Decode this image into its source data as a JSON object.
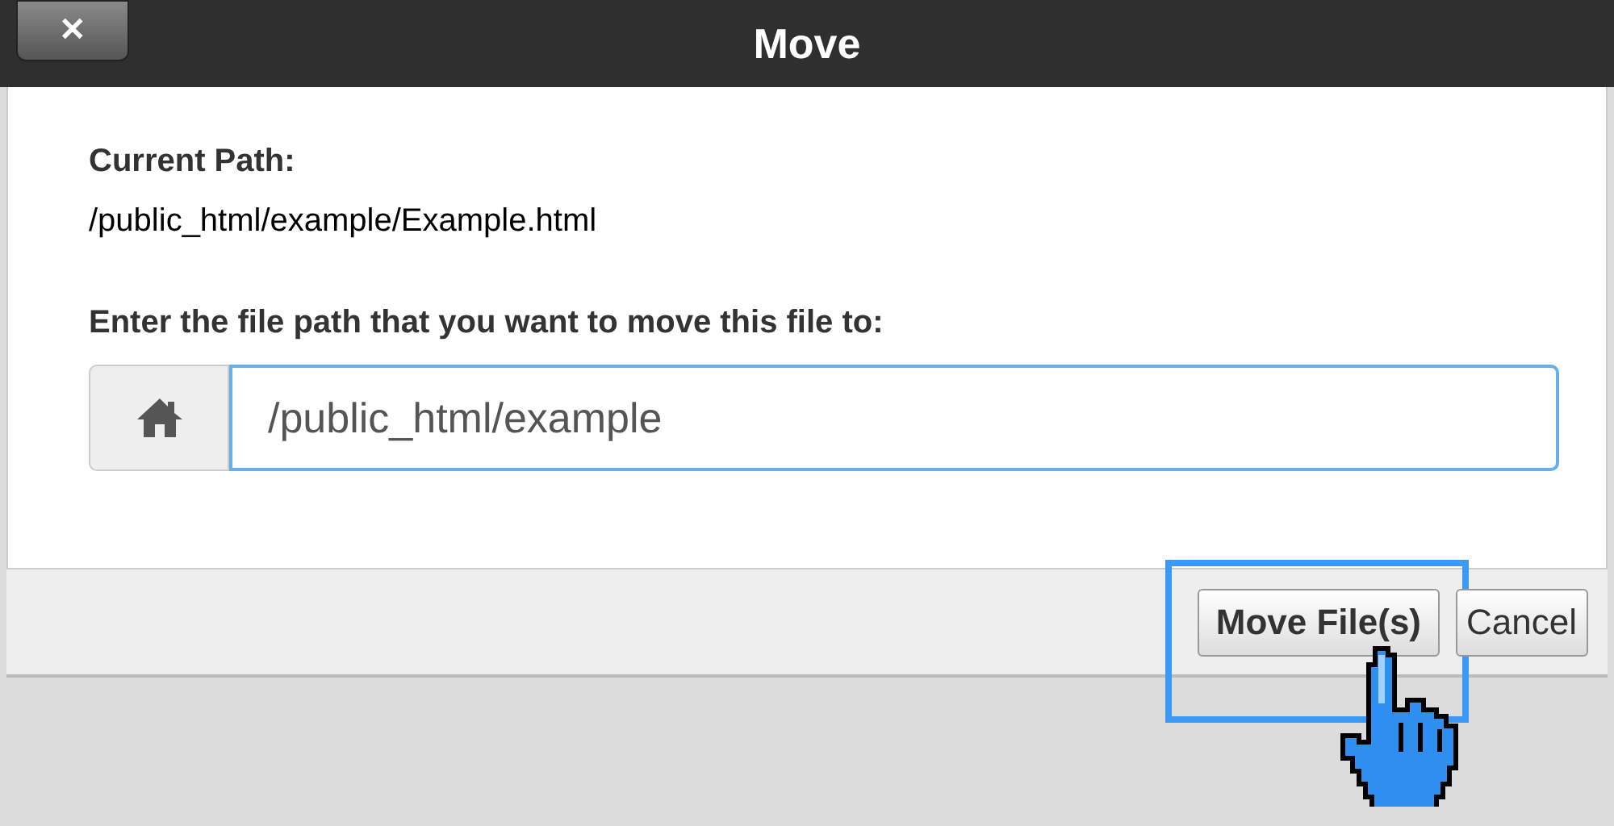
{
  "dialog": {
    "title": "Move",
    "close_label": "✕"
  },
  "current_path": {
    "label": "Current Path:",
    "value": "/public_html/example/Example.html"
  },
  "destination": {
    "label": "Enter the file path that you want to move this file to:",
    "value": "/public_html/example"
  },
  "buttons": [
    {
      "label": "Move File(s)",
      "kind": "primary",
      "highlighted": true
    },
    {
      "label": "Cancel",
      "kind": "secondary",
      "highlighted": false
    }
  ]
}
